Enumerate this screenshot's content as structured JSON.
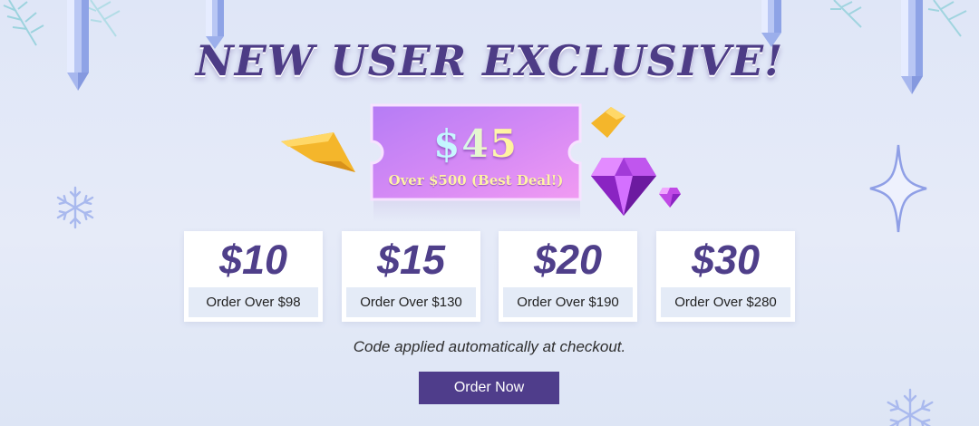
{
  "headline": "NEW USER EXCLUSIVE!",
  "featured_coupon": {
    "amount": "$45",
    "condition": "Over $500 (Best Deal!)"
  },
  "coupons": [
    {
      "amount": "$10",
      "condition": "Order Over $98"
    },
    {
      "amount": "$15",
      "condition": "Order Over $130"
    },
    {
      "amount": "$20",
      "condition": "Order Over $190"
    },
    {
      "amount": "$30",
      "condition": "Order Over $280"
    }
  ],
  "note": "Code applied automatically at checkout.",
  "cta": {
    "label": "Order Now"
  },
  "colors": {
    "brand_purple": "#4f3d8b",
    "coupon_gradient_start": "#b57cf5",
    "coupon_gradient_end": "#f19bf2",
    "gold": "#f6c23a"
  },
  "icons": [
    "crystal-icon",
    "leaf-icon",
    "snowflake-icon",
    "sparkle-icon",
    "gold-ribbon-icon",
    "diamond-icon"
  ]
}
